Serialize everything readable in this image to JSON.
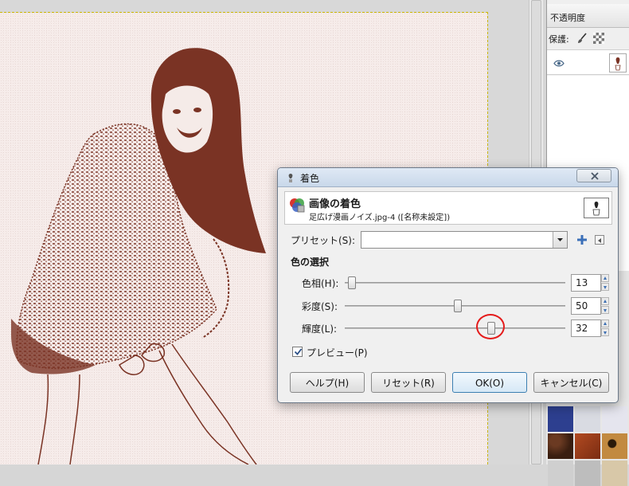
{
  "dock": {
    "tab_label": "不透明度",
    "lock_label": "保護:",
    "layer_name": ""
  },
  "dialog": {
    "title": "着色",
    "header_title": "画像の着色",
    "header_subtitle": "足広げ漫画ノイズ.jpg-4 ([名称未設定])",
    "preset_label": "プリセット(S):",
    "preset_value": "",
    "section_label": "色の選択",
    "sliders": [
      {
        "label": "色相(H):",
        "value": "13",
        "fraction": 0.0
      },
      {
        "label": "彩度(S):",
        "value": "50",
        "fraction": 0.5
      },
      {
        "label": "輝度(L):",
        "value": "32",
        "fraction": 0.66
      }
    ],
    "preview_label": "プレビュー(P)",
    "preview_checked": true,
    "buttons": {
      "help": "ヘルプ(H)",
      "reset": "リセット(R)",
      "ok": "OK(O)",
      "cancel": "キャンセル(C)"
    }
  },
  "colors": {
    "accent": "#3c7fb1",
    "annotation": "#e41b1b",
    "sepia": "#7a3324"
  }
}
